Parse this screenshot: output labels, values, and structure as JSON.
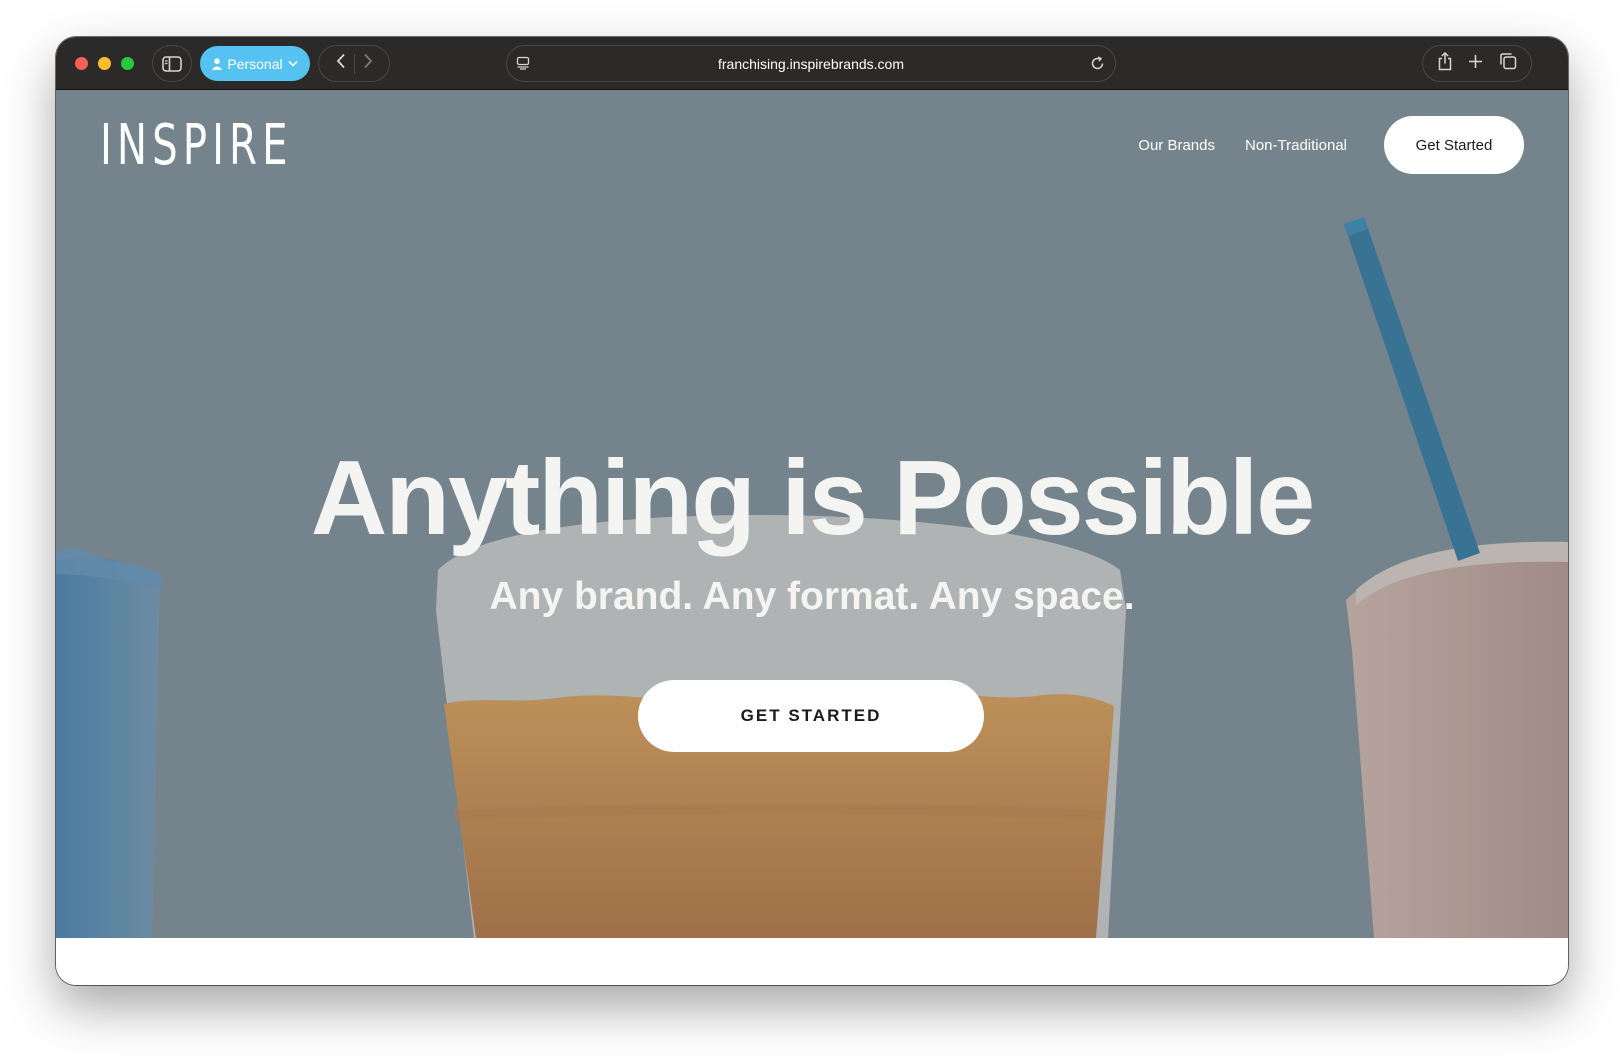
{
  "browser": {
    "profile_label": "Personal",
    "url": "franchising.inspirebrands.com"
  },
  "site": {
    "logo_text": "INSPIRE",
    "nav": {
      "links": [
        "Our Brands",
        "Non-Traditional"
      ],
      "cta": "Get Started"
    },
    "hero": {
      "title": "Anything is Possible",
      "subtitle": "Any brand. Any format. Any space.",
      "cta": "GET STARTED"
    }
  },
  "icons": {
    "sidebar": "sidebar-icon",
    "profile": "person-icon",
    "profile_menu": "chevron-down-icon",
    "back": "chevron-left-icon",
    "forward": "chevron-right-icon",
    "page_menu": "page-menu-icon",
    "reload": "reload-icon",
    "share": "share-icon",
    "new_tab": "plus-icon",
    "tab_overview": "tabs-icon"
  },
  "colors": {
    "toolbar": "#2b2a28",
    "profile_accent": "#56c2f1",
    "hero_background": "#7a888f",
    "straw": "#1f6f9b",
    "drink_orange": "#d58a3e"
  }
}
